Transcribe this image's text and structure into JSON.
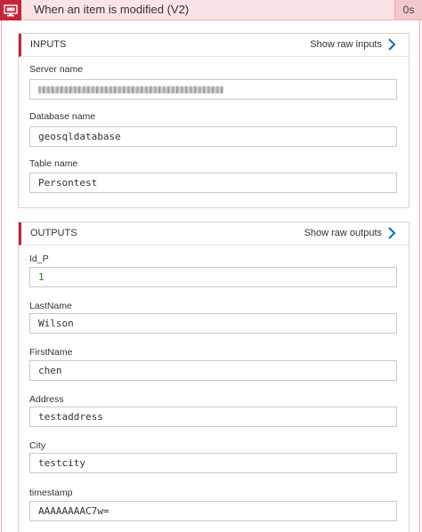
{
  "header": {
    "title": "When an item is modified (V2)",
    "duration": "0s",
    "accent": "#c4243b"
  },
  "inputs": {
    "section_label": "INPUTS",
    "raw_link": "Show raw inputs",
    "fields": [
      {
        "label": "Server name",
        "value": "",
        "redacted": true
      },
      {
        "label": "Database name",
        "value": "geosqldatabase"
      },
      {
        "label": "Table name",
        "value": "Persontest"
      }
    ]
  },
  "outputs": {
    "section_label": "OUTPUTS",
    "raw_link": "Show raw outputs",
    "fields": [
      {
        "label": "Id_P",
        "value": "1"
      },
      {
        "label": "LastName",
        "value": "Wilson"
      },
      {
        "label": "FirstName",
        "value": "chen"
      },
      {
        "label": "Address",
        "value": "testaddress"
      },
      {
        "label": "City",
        "value": "testcity"
      },
      {
        "label": "timestamp",
        "value": "AAAAAAAAC7w="
      }
    ]
  }
}
